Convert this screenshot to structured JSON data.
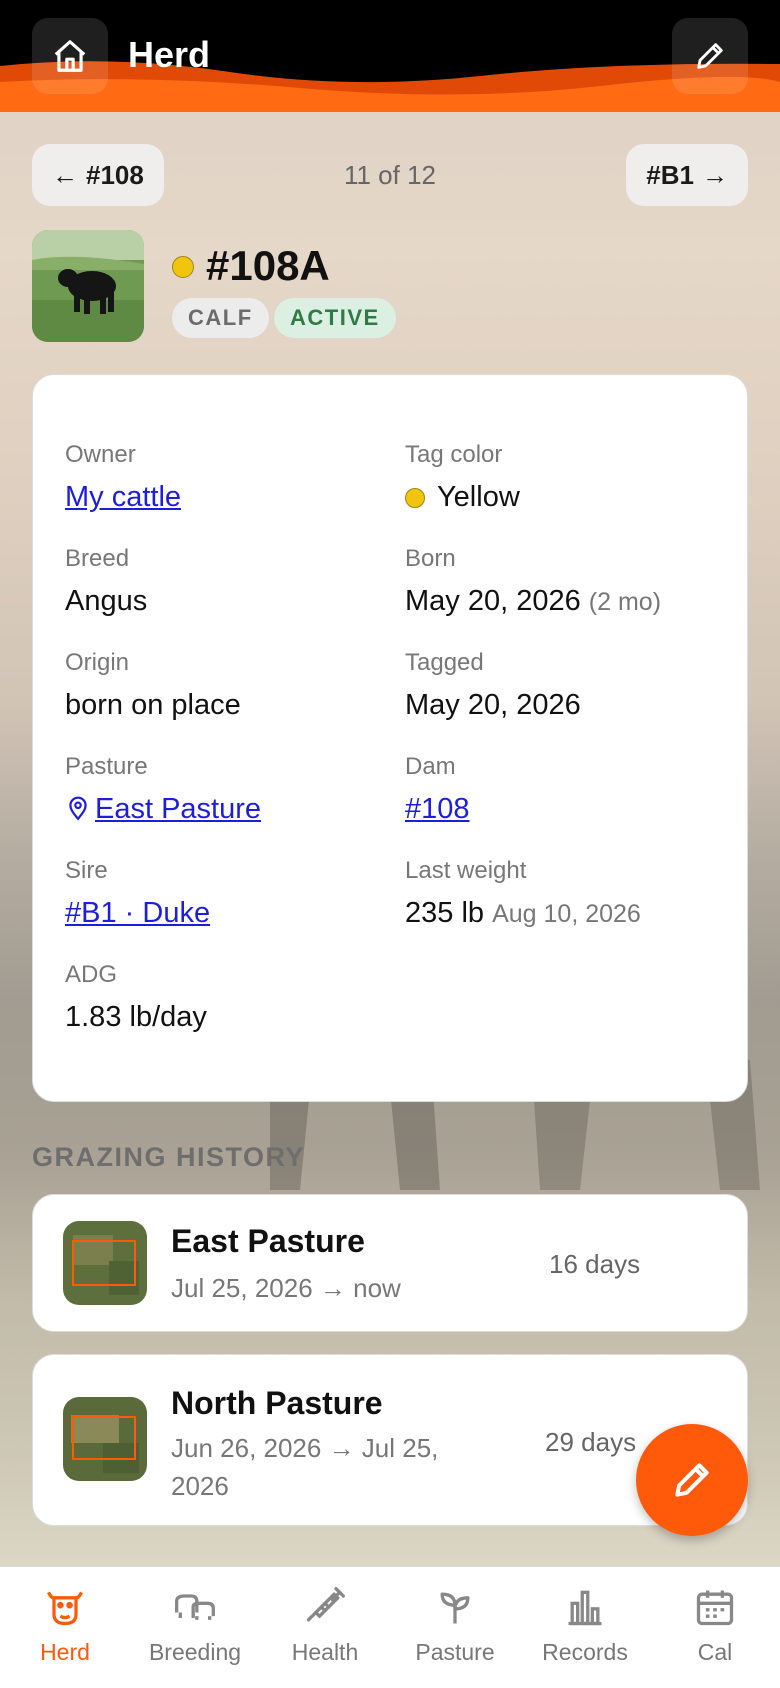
{
  "header": {
    "title": "Herd",
    "home_icon": "home-icon",
    "edit_icon": "pencil-icon"
  },
  "nav": {
    "prev_label": "#108",
    "next_label": "#B1",
    "count_text": "11 of 12"
  },
  "animal": {
    "id": "#108A",
    "tag_color_hex": "#f1c40f",
    "badges": [
      "CALF",
      "ACTIVE"
    ]
  },
  "details": {
    "owner": {
      "label": "Owner",
      "value": "My cattle"
    },
    "tag_color": {
      "label": "Tag color",
      "value": "Yellow"
    },
    "breed": {
      "label": "Breed",
      "value": "Angus"
    },
    "born": {
      "label": "Born",
      "value": "May 20, 2026",
      "age": "(2 mo)"
    },
    "origin": {
      "label": "Origin",
      "value": "born on place"
    },
    "tagged": {
      "label": "Tagged",
      "value": "May 20, 2026"
    },
    "pasture": {
      "label": "Pasture",
      "value": "East Pasture"
    },
    "dam": {
      "label": "Dam",
      "value": "#108"
    },
    "sire": {
      "label": "Sire",
      "value": "#B1 · Duke"
    },
    "last_weight": {
      "label": "Last weight",
      "value": "235 lb",
      "date": "Aug 10, 2026"
    },
    "adg": {
      "label": "ADG",
      "value": "1.83 lb/day"
    }
  },
  "grazing": {
    "title": "GRAZING HISTORY",
    "items": [
      {
        "name": "East Pasture",
        "dates": "Jul 25, 2026 → now",
        "days": "16 days"
      },
      {
        "name": "North Pasture",
        "dates": "Jun 26, 2026 → Jul 25, 2026",
        "days": "29 days"
      }
    ]
  },
  "tabs": [
    {
      "label": "Herd",
      "icon": "cow-head-icon",
      "active": true
    },
    {
      "label": "Breeding",
      "icon": "cattle-pair-icon",
      "active": false
    },
    {
      "label": "Health",
      "icon": "syringe-icon",
      "active": false
    },
    {
      "label": "Pasture",
      "icon": "sprout-icon",
      "active": false
    },
    {
      "label": "Records",
      "icon": "bar-chart-icon",
      "active": false
    },
    {
      "label": "Cal",
      "icon": "calendar-icon",
      "active": false
    }
  ],
  "colors": {
    "accent": "#ff5a0a",
    "link": "#1d1de0",
    "active_badge_text": "#2f7a45"
  }
}
